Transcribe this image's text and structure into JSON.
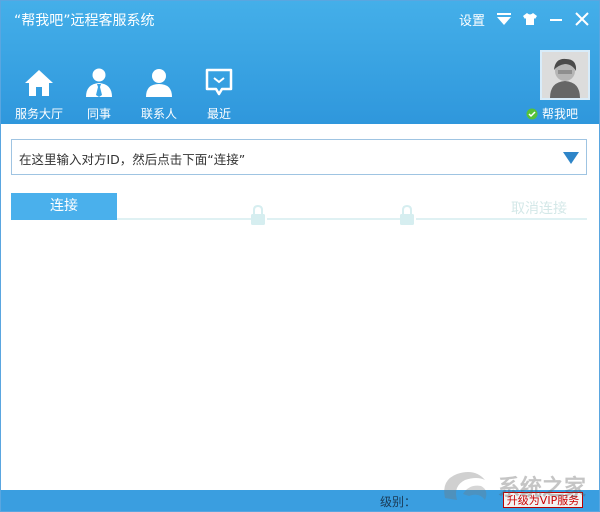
{
  "window": {
    "title": "“帮我吧”远程客服系统"
  },
  "top_bar": {
    "settings_label": "设置"
  },
  "nav": [
    {
      "label": "服务大厅",
      "icon": "home-icon"
    },
    {
      "label": "同事",
      "icon": "colleague-icon"
    },
    {
      "label": "联系人",
      "icon": "contact-icon"
    },
    {
      "label": "最近",
      "icon": "recent-chat-icon"
    }
  ],
  "user": {
    "name": "帮我吧"
  },
  "search": {
    "placeholder": "在这里输入对方ID，然后点击下面“连接”"
  },
  "actions": {
    "connect": "连接",
    "disconnect": "取消连接"
  },
  "status": {
    "level_label": "级别：",
    "upgrade_label": "升级为VIP服务"
  },
  "watermark": {
    "text": "系统之家"
  },
  "colors": {
    "header": "#3aa3e4",
    "button": "#4ab0ec",
    "border": "#9fc4e2"
  }
}
